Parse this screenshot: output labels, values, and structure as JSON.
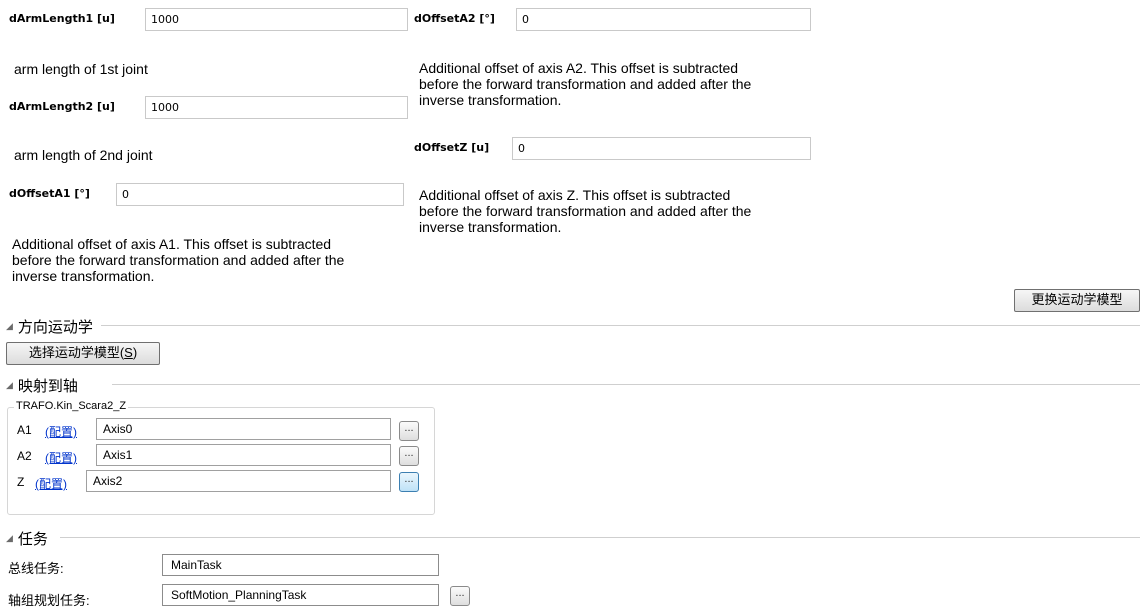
{
  "params": {
    "arm1": {
      "label": "dArmLength1 [u]",
      "value": "1000",
      "desc": "arm length of 1st joint"
    },
    "arm2": {
      "label": "dArmLength2 [u]",
      "value": "1000",
      "desc": "arm length of 2nd joint"
    },
    "offA1": {
      "label": "dOffsetA1 [°]",
      "value": "0",
      "desc_lines": [
        "Additional offset of axis A1. This offset is subtracted",
        "before the forward transformation and added after the",
        "inverse transformation."
      ]
    },
    "offA2": {
      "label": "dOffsetA2 [°]",
      "value": "0",
      "desc_lines": [
        "Additional offset of axis A2. This offset is subtracted",
        "before the forward transformation and added after the",
        "inverse transformation."
      ]
    },
    "offZ": {
      "label": "dOffsetZ [u]",
      "value": "0",
      "desc_lines": [
        "Additional offset of axis Z. This offset is subtracted",
        "before the forward transformation and added after the",
        "inverse transformation."
      ]
    }
  },
  "change_model_button": "更换运动学模型",
  "orientation_section": {
    "title": "方向运动学",
    "select_button_text": "选择运动学模型(",
    "select_button_key": "S",
    "select_button_close": ")"
  },
  "mapping_section": {
    "title": "映射到轴",
    "group_title": "TRAFO.Kin_Scara2_Z",
    "config_label": "(配置)",
    "axes": [
      {
        "name": "A1",
        "value": "Axis0"
      },
      {
        "name": "A2",
        "value": "Axis1"
      },
      {
        "name": "Z",
        "value": "Axis2"
      }
    ],
    "browse_label": "..."
  },
  "task_section": {
    "title": "任务",
    "bus_task_label": "总线任务:",
    "bus_task_value": "MainTask",
    "planning_task_label": "轴组规划任务:",
    "planning_task_value": "SoftMotion_PlanningTask",
    "browse_label": "..."
  },
  "colors": {
    "link": "#0033cc",
    "section_line": "#cfcfcf"
  }
}
